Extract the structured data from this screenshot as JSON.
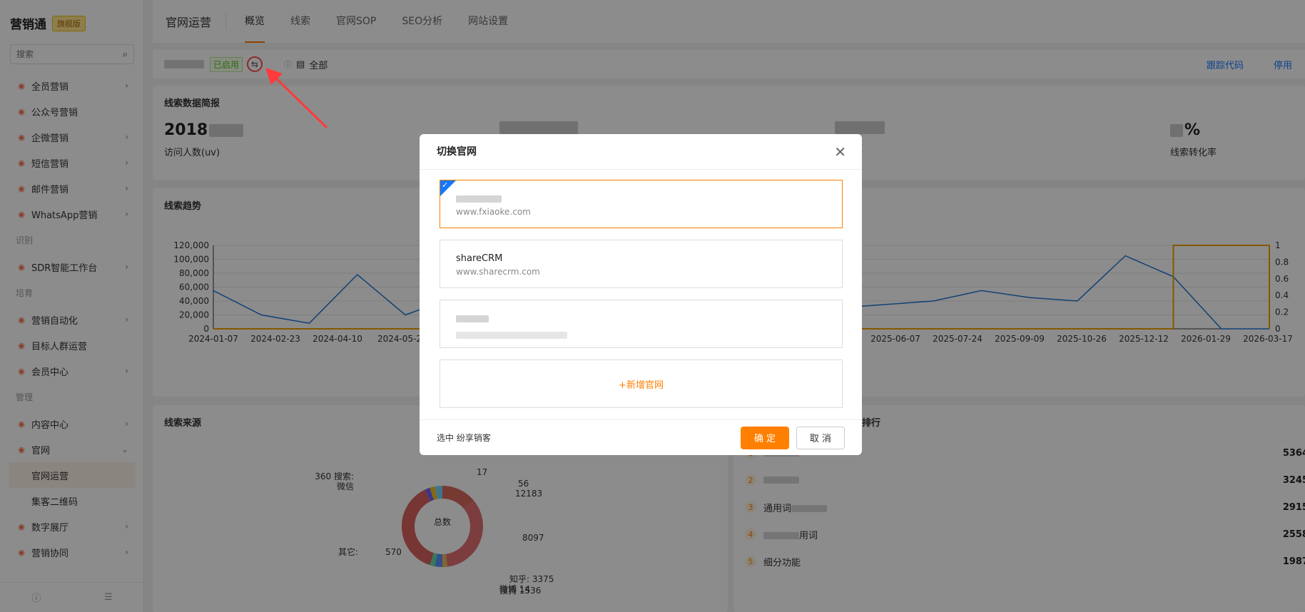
{
  "sidebar": {
    "brand": "营销通",
    "edition": "旗舰版",
    "search_placeholder": "搜索",
    "items": [
      {
        "label": "全员营销",
        "icon": "person-icon",
        "chevron": true
      },
      {
        "label": "公众号营销",
        "icon": "wechat-icon",
        "chevron": false
      },
      {
        "label": "企微营销",
        "icon": "wecom-icon",
        "chevron": true
      },
      {
        "label": "短信营销",
        "icon": "sms-icon",
        "chevron": true
      },
      {
        "label": "邮件营销",
        "icon": "mail-icon",
        "chevron": true
      },
      {
        "label": "WhatsApp营销",
        "icon": "whatsapp-icon",
        "chevron": true
      }
    ],
    "group_identify": "识别",
    "items_identify": [
      {
        "label": "SDR智能工作台",
        "icon": "robot-icon",
        "chevron": true
      }
    ],
    "group_nurture": "培育",
    "items_nurture": [
      {
        "label": "营销自动化",
        "icon": "automation-icon",
        "chevron": true
      },
      {
        "label": "目标人群运营",
        "icon": "audience-icon",
        "chevron": false
      },
      {
        "label": "会员中心",
        "icon": "member-icon",
        "chevron": true
      }
    ],
    "group_manage": "管理",
    "items_manage": [
      {
        "label": "内容中心",
        "icon": "content-icon",
        "chevron": true
      },
      {
        "label": "官网",
        "icon": "website-icon",
        "chevron": true,
        "expanded": true
      }
    ],
    "sub_items": [
      {
        "label": "官网运营",
        "active": true
      },
      {
        "label": "集客二维码",
        "active": false
      }
    ],
    "items_bottom": [
      {
        "label": "数字展厅",
        "icon": "showroom-icon",
        "chevron": true
      },
      {
        "label": "营销协同",
        "icon": "collab-icon",
        "chevron": true
      }
    ]
  },
  "topnav": {
    "title": "官网运营",
    "tabs": [
      "概览",
      "线索",
      "官网SOP",
      "SEO分析",
      "网站设置"
    ],
    "active_tab": 0
  },
  "toolbar": {
    "status": "已启用",
    "switch_icon": "⇆",
    "filter_value": "全部",
    "links": [
      "跟踪代码",
      "停用"
    ]
  },
  "summary": {
    "title": "线索数据简报",
    "kpis": [
      {
        "value": "2018",
        "label": "访问人数(uv)"
      },
      {
        "value": "",
        "label": ""
      },
      {
        "value": "",
        "label": "线索数"
      },
      {
        "value": "%",
        "label": "线索转化率"
      }
    ]
  },
  "trend": {
    "title": "线索趋势",
    "left_ticks": [
      "120,000",
      "100,000",
      "80,000",
      "60,000",
      "40,000",
      "20,000",
      "0"
    ],
    "right_ticks": [
      "1",
      "0.8",
      "0.6",
      "0.4",
      "0.2",
      "0"
    ],
    "x_ticks_left": [
      "2024-01-07",
      "2024-02-23",
      "2024-04-10",
      "2024-05-2"
    ],
    "x_ticks_right": [
      "2025-06-07",
      "2025-07-24",
      "2025-09-09",
      "2025-10-26",
      "2025-12-12",
      "2026-01-29",
      "2026-03-17"
    ]
  },
  "source": {
    "title": "线索来源",
    "center_label": "总数",
    "labels": [
      "360 搜索:",
      "微信",
      "17",
      "56",
      "12183",
      "8097",
      "其它:",
      "570",
      "知乎: 3375",
      "微博 14",
      "搜狗 1536"
    ]
  },
  "ranking": {
    "title": "排行",
    "rows": [
      {
        "no": "1",
        "name": "",
        "value": "5364"
      },
      {
        "no": "2",
        "name": "",
        "value": "3245"
      },
      {
        "no": "3",
        "name": "通用词",
        "value": "2915"
      },
      {
        "no": "4",
        "name": "用词",
        "value": "2558"
      },
      {
        "no": "5",
        "name": "细分功能",
        "value": "1987"
      }
    ]
  },
  "modal": {
    "title": "切换官网",
    "sites": [
      {
        "name": "",
        "url": "www.fxiaoke.com",
        "selected": true
      },
      {
        "name": "shareCRM",
        "url": "www.sharecrm.com",
        "selected": false
      },
      {
        "name": "",
        "url": "",
        "selected": false
      }
    ],
    "add_label": "+新增官网",
    "selected_text": "选中 纷享销客",
    "ok_label": "确 定",
    "cancel_label": "取 消"
  },
  "chart_data": {
    "type": "line",
    "title": "线索趋势",
    "y_left_range": [
      0,
      120000
    ],
    "y_right_range": [
      0,
      1
    ],
    "x_range": [
      "2024-01-07",
      "2026-03-17"
    ],
    "series": [
      {
        "values": [
          55000,
          20000,
          8000,
          78000,
          20000,
          45000,
          50000,
          20000,
          35000,
          25000,
          40000,
          30000,
          25000,
          30000,
          35000,
          40000,
          55000,
          45000,
          40000,
          105000,
          75000,
          0,
          0
        ]
      },
      {
        "values": [
          0,
          0,
          0,
          0,
          0,
          0,
          0,
          0,
          0,
          0,
          0,
          0,
          0,
          0,
          0,
          0,
          0,
          0,
          0,
          0,
          1,
          1,
          0
        ]
      }
    ],
    "colors": {
      "line": "#1f77d4",
      "step": "#f0a000"
    }
  }
}
